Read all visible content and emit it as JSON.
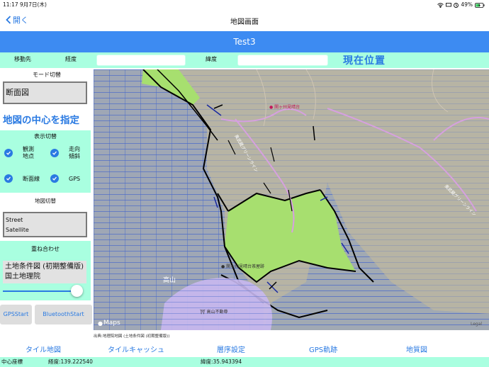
{
  "status_bar": {
    "time": "11:17",
    "date": "9月7日(木)",
    "battery": "49%"
  },
  "nav": {
    "back_label": "開く",
    "title": "地図画面"
  },
  "banner": {
    "title": "Test3"
  },
  "coords_bar": {
    "dest_label": "移動先",
    "lon_label": "経度",
    "lat_label": "緯度",
    "current_button": "現在位置"
  },
  "sidebar": {
    "mode_header": "モード切替",
    "mode_value": "断面図",
    "center_button": "地図の中心を指定",
    "display_header": "表示切替",
    "toggles": [
      {
        "label": "観測\n地点",
        "checked": true
      },
      {
        "label": "走向\n傾斜",
        "checked": true
      },
      {
        "label": "断面線",
        "checked": true
      },
      {
        "label": "GPS",
        "checked": true
      }
    ],
    "map_switch_header": "地図切替",
    "map_options": [
      "Street",
      "Satellite"
    ],
    "overlay_header": "重ね合わせ",
    "overlay_value": "土地条件図 (初期整備版) 国土地理院",
    "overlay_opacity": 0.9,
    "gps_start": "GPSStart",
    "bluetooth_start": "BluetoothStart"
  },
  "map": {
    "labels": {
      "place1": "関ヶ州見晴台",
      "place2": "関ヶ州見晴台茶屋跡",
      "place3": "高山不動尊",
      "peak": "高山",
      "road1": "奥武蔵グリーンライン",
      "road2": "奥武蔵グリーンライン"
    },
    "attribution": "Maps",
    "legal": "Legal",
    "source": "出典:地理院地図 (土地条件図 (初期整備版))"
  },
  "tabs": [
    "タイル地図",
    "タイルキャッシュ",
    "層序設定",
    "GPS軌跡",
    "地質図"
  ],
  "footer": {
    "center_label": "中心座標",
    "lon": "経度:139.222540",
    "lat": "緯度:35.943394"
  },
  "colors": {
    "accent": "#2a7ae2",
    "banner": "#3d8bf2",
    "mint": "#a9ffe0",
    "green_zone": "#a7df6f"
  }
}
